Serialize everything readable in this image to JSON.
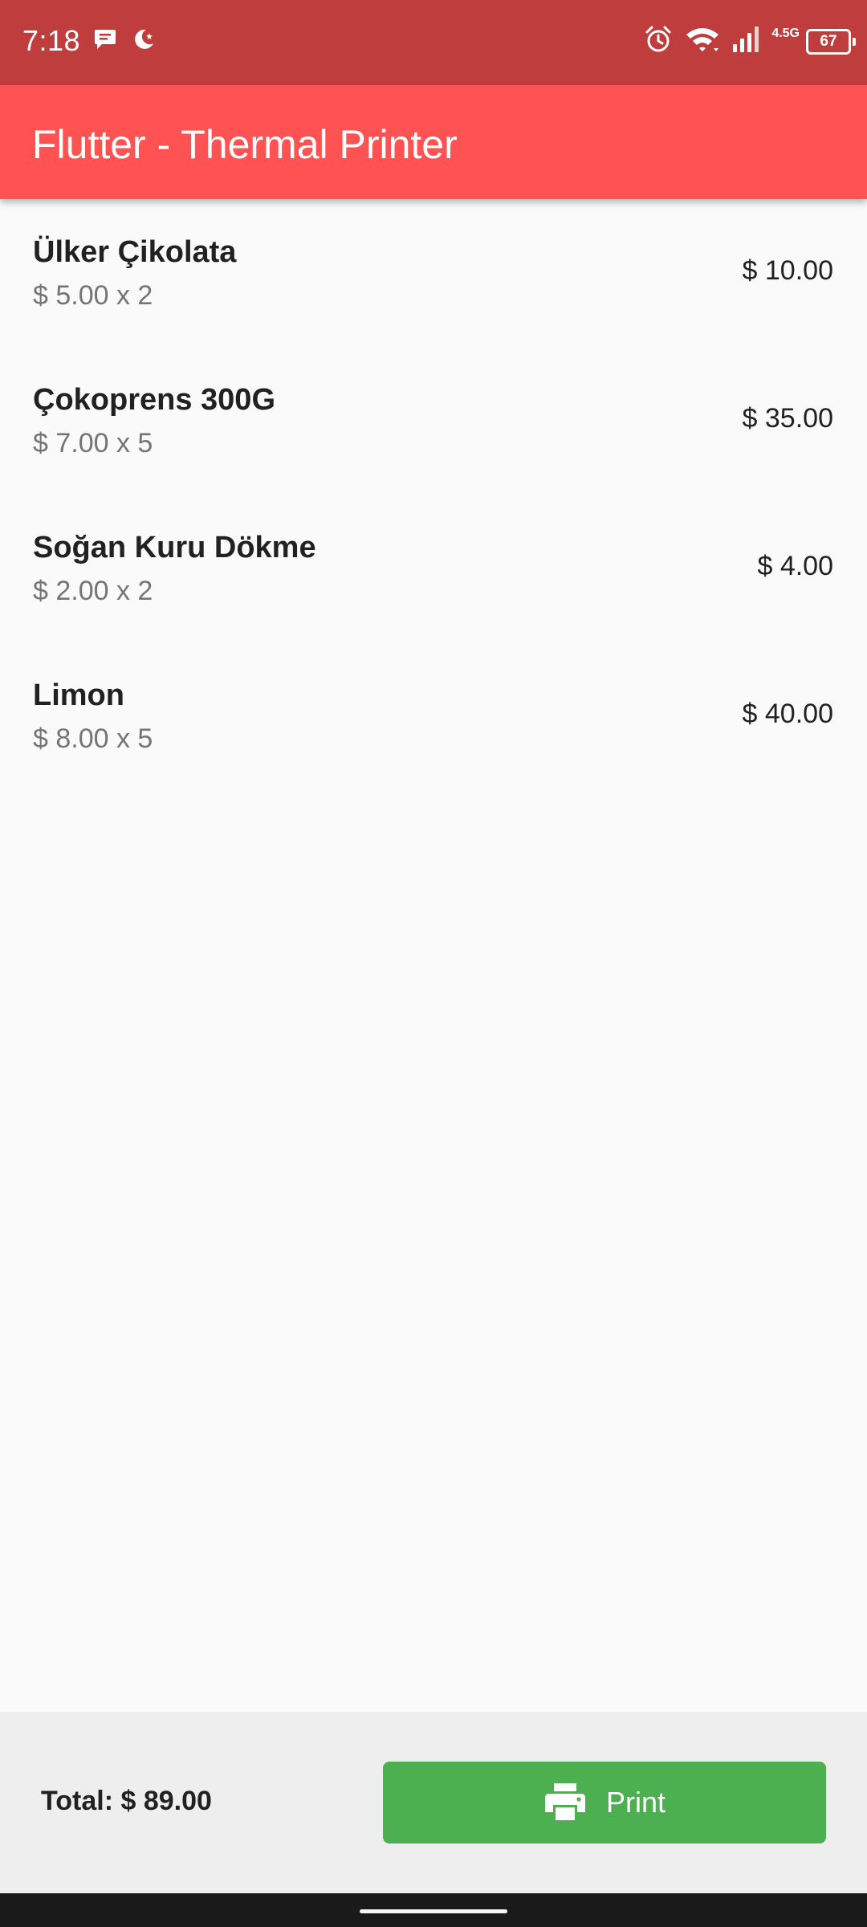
{
  "status_bar": {
    "time": "7:18",
    "network_type": "4.5G",
    "battery": "67",
    "icons": [
      "message-icon",
      "moon-icon",
      "alarm-icon",
      "wifi-icon",
      "signal-icon",
      "battery-icon"
    ]
  },
  "app_bar": {
    "title": "Flutter - Thermal Printer",
    "color": "#ff5252"
  },
  "items": [
    {
      "name": "Ülker Çikolata",
      "detail": "$ 5.00 x 2",
      "total": "$ 10.00"
    },
    {
      "name": "Çokoprens 300G",
      "detail": "$ 7.00 x 5",
      "total": "$ 35.00"
    },
    {
      "name": "Soğan Kuru Dökme",
      "detail": "$ 2.00 x 2",
      "total": "$ 4.00"
    },
    {
      "name": "Limon",
      "detail": "$ 8.00 x 5",
      "total": "$ 40.00"
    }
  ],
  "footer": {
    "total": "Total: $ 89.00",
    "print_label": "Print",
    "print_icon": "printer-icon",
    "button_color": "#4caf50"
  }
}
